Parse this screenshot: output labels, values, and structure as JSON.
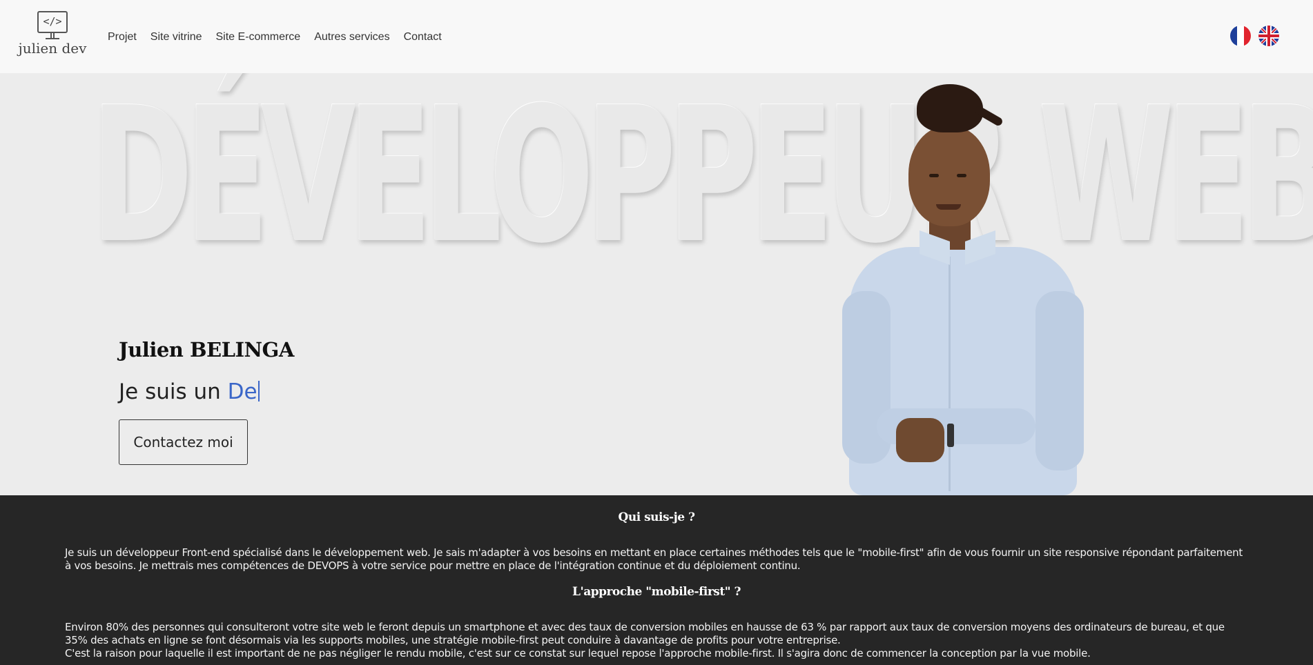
{
  "header": {
    "logo_code": "</>",
    "logo_text": "julien dev",
    "nav": [
      "Projet",
      "Site vitrine",
      "Site E-commerce",
      "Autres services",
      "Contact"
    ],
    "languages": [
      {
        "name": "french-flag-icon",
        "colors": [
          "#1e3f9a",
          "#ffffff",
          "#e1242e"
        ]
      },
      {
        "name": "uk-flag-icon",
        "colors": [
          "#1f3d9a",
          "#ffffff",
          "#d01f2f"
        ]
      }
    ]
  },
  "hero": {
    "background_word": "DÉVELOPPEUR WEB",
    "name": "Julien BELINGA",
    "tagline_prefix": "Je suis un",
    "typed_text": "De",
    "cta_label": "Contactez moi",
    "accent_color": "#3a66c8"
  },
  "about": {
    "who_title": "Qui suis-je ?",
    "who_text": "Je suis un développeur Front-end spécialisé dans le développement web. Je sais m'adapter à vos besoins en mettant en place certaines méthodes tels que le \"mobile-first\" afin de vous fournir un site responsive répondant parfaitement à vos besoins. Je mettrais mes compétences de DEVOPS à votre service pour mettre en place de l'intégration continue et du déploiement continu.",
    "mobile_title": "L'approche \"mobile-first\" ?",
    "mobile_text_1": "Environ 80% des personnes qui consulteront votre site web le feront depuis un smartphone et avec des taux de conversion mobiles en hausse de 63 % par rapport aux taux de conversion moyens des ordinateurs de bureau, et que 35% des achats en ligne se font désormais via les supports mobiles, une stratégie mobile-first peut conduire à davantage de profits pour votre entreprise.",
    "mobile_text_2": "C'est la raison pour laquelle il est important de ne pas négliger le rendu mobile, c'est sur ce constat sur lequel repose l'approche mobile-first. Il s'agira donc de commencer la conception par la vue mobile."
  }
}
